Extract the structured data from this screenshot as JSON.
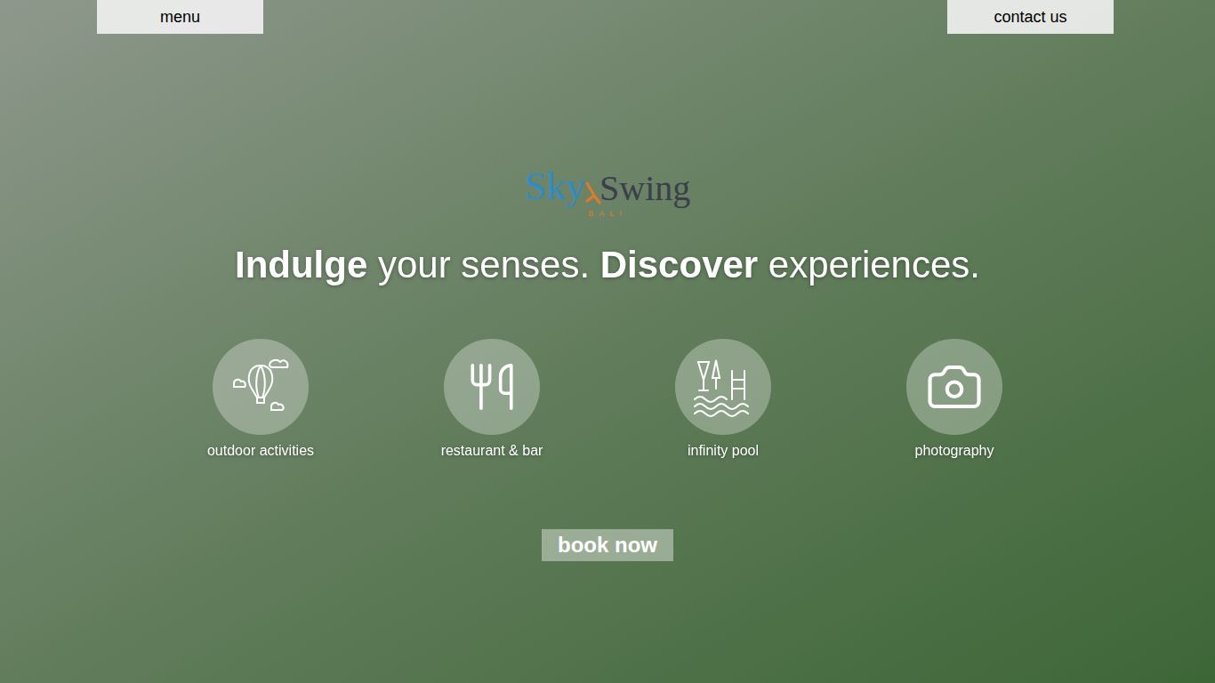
{
  "nav": {
    "menu": "menu",
    "contact": "contact us"
  },
  "logo": {
    "first": "Sky",
    "second": "Swing",
    "sub": "BALI"
  },
  "headline": [
    {
      "text": "Indulge",
      "bold": true
    },
    {
      "text": " your senses. ",
      "bold": false
    },
    {
      "text": "Discover",
      "bold": true
    },
    {
      "text": " experiences.",
      "bold": false
    }
  ],
  "features": [
    {
      "label": "outdoor activities",
      "kind": "balloon"
    },
    {
      "label": "restaurant & bar",
      "kind": "utensils"
    },
    {
      "label": "infinity pool",
      "kind": "pool"
    },
    {
      "label": "photography",
      "kind": "camera"
    }
  ],
  "cta": "book now"
}
